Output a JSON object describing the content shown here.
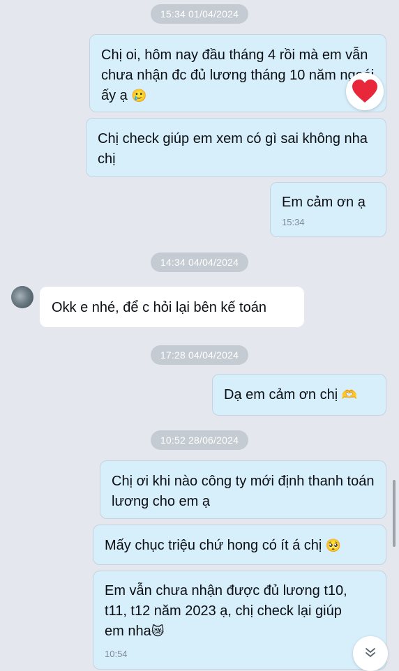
{
  "timestamps": [
    "15:34 01/04/2024",
    "14:34 04/04/2024",
    "17:28 04/04/2024",
    "10:52 28/06/2024"
  ],
  "messages": [
    {
      "text": "Chị oi, hôm nay đầu tháng 4 rồi mà em vẫn chưa nhận đc đủ lương tháng 10 năm ngoái ấy ạ",
      "emoji": "🥲",
      "reaction": "heart-icon"
    },
    {
      "text": "Chị check giúp em xem có gì sai không nha chị"
    },
    {
      "text": "Em cảm ơn ạ",
      "time": "15:34"
    },
    {
      "text": "Okk e nhé, để c hỏi lại bên kế toán"
    },
    {
      "text": "Dạ em cảm ơn chị",
      "emoji": "🫶"
    },
    {
      "text": "Chị ơi khi nào công ty mới định thanh toán lương cho em ạ"
    },
    {
      "text": "Mấy chục triệu chứ hong có ít á chị",
      "emoji": "🥺"
    },
    {
      "text": "Em vẫn chưa nhận được đủ lương t10, t11, t12 năm 2023 ạ, chị check lại giúp em nha",
      "emoji": "😿",
      "time": "10:54"
    }
  ],
  "colors": {
    "outgoing": "#d7eefb",
    "incoming": "#ffffff",
    "background": "#e4e8ee",
    "heart": "#e8283a"
  },
  "icons": {
    "reaction": "heart-icon",
    "scroll": "chevron-down-icon",
    "avatar": "avatar"
  }
}
